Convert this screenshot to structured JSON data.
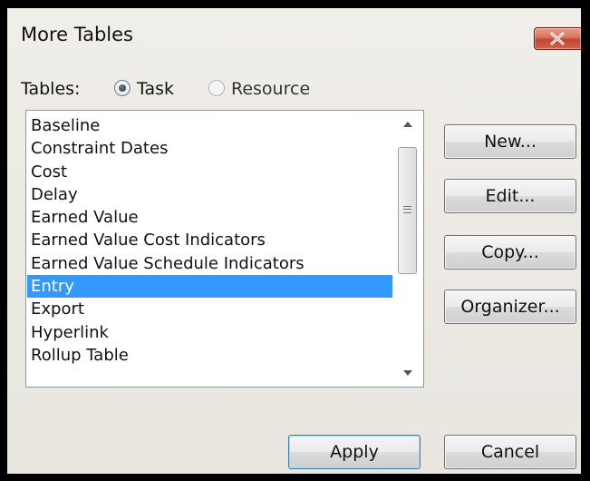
{
  "window": {
    "title": "More Tables"
  },
  "tables": {
    "label": "Tables:",
    "options": [
      {
        "label": "Task",
        "checked": true
      },
      {
        "label": "Resource",
        "checked": false
      }
    ]
  },
  "list": {
    "items": [
      "Baseline",
      "Constraint Dates",
      "Cost",
      "Delay",
      "Earned Value",
      "Earned Value Cost Indicators",
      "Earned Value Schedule Indicators",
      "Entry",
      "Export",
      "Hyperlink",
      "Rollup Table"
    ],
    "selected": "Entry"
  },
  "buttons": {
    "new": "New...",
    "edit": "Edit...",
    "copy": "Copy...",
    "organizer": "Organizer...",
    "apply": "Apply",
    "cancel": "Cancel"
  },
  "colors": {
    "selection": "#3399ff",
    "close_button": "#c3452f"
  }
}
